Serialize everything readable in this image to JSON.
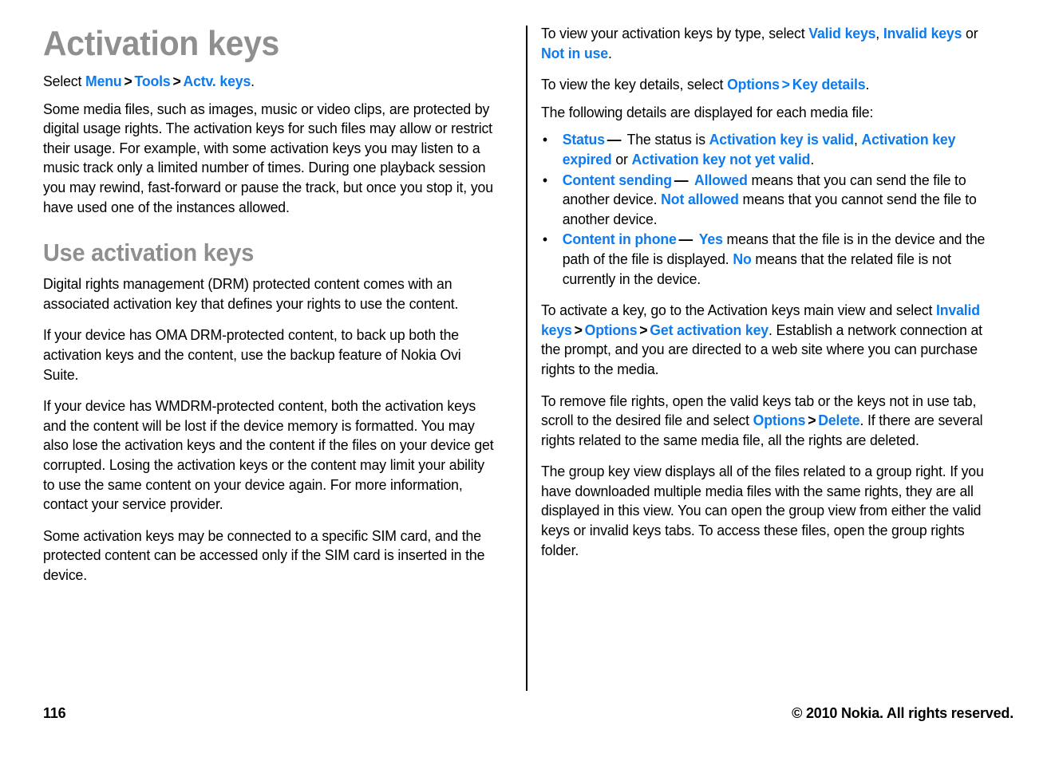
{
  "document": {
    "title": "Activation keys",
    "colors": {
      "heading_gray": "#8f8f8f",
      "link_blue": "#0d7bee",
      "body_black": "#000000",
      "page_background": "#ffffff"
    }
  },
  "left_column": {
    "heading": "Activation keys",
    "select_line": {
      "prefix": "Select ",
      "item1": "Menu",
      "sep1": ">",
      "item2": "Tools",
      "sep2": ">",
      "item3": "Actv. keys",
      "suffix": "."
    },
    "intro_paragraph": "Some media files, such as images, music or video clips, are protected by digital usage rights. The activation keys for such files may allow or restrict their usage. For example, with some activation keys you may listen to a music track only a limited number of times. During one playback session you may rewind, fast-forward or pause the track, but once you stop it, you have used one of the instances allowed.",
    "subheading": "Use activation keys",
    "paragraphs": [
      "Digital rights management (DRM) protected content comes with an associated activation key that defines your rights to use the content.",
      "If your device has OMA DRM-protected content, to back up both the activation keys and the content, use the backup feature of Nokia Ovi Suite.",
      "If your device has WMDRM-protected content, both the activation keys and the content will be lost if the device memory is formatted. You may also lose the activation keys and the content if the files on your device get corrupted. Losing the activation keys or the content may limit your ability to use the same content on your device again. For more information, contact your service provider.",
      "Some activation keys may be connected to a specific SIM card, and the protected content can be accessed only if the SIM card is inserted in the device."
    ]
  },
  "right_column": {
    "view_by_type": {
      "prefix": "To view your activation keys by type, select ",
      "link1": "Valid keys",
      "comma": ", ",
      "link2": "Invalid keys",
      "or": " or ",
      "link3": "Not in use",
      "suffix": "."
    },
    "key_details_line": {
      "prefix": "To view the key details, select ",
      "link1": "Options",
      "sep": ">",
      "link2": "Key details",
      "suffix": "."
    },
    "details_intro": "The following details are displayed for each media file:",
    "bullets": [
      {
        "bullet_char": "•",
        "term": "Status",
        "dash": "—",
        "text_1": " The status is ",
        "value_1": "Activation key is valid",
        "text_2": ", ",
        "value_2": "Activation key expired",
        "text_3": " or ",
        "value_3": "Activation key not yet valid",
        "text_4": "."
      },
      {
        "bullet_char": "•",
        "term": "Content sending",
        "dash": "—",
        "text_1": " ",
        "value_1": "Allowed",
        "text_2": " means that you can send the file to another device. ",
        "value_2": "Not allowed",
        "text_3": " means that you cannot send the file to another device.",
        "value_3": "",
        "text_4": ""
      },
      {
        "bullet_char": "•",
        "term": "Content in phone",
        "dash": "—",
        "text_1": " ",
        "value_1": "Yes",
        "text_2": " means that the file is in the device and the path of the file is displayed. ",
        "value_2": "No",
        "text_3": " means that the related file is not currently in the device.",
        "value_3": "",
        "text_4": ""
      }
    ],
    "activate_key": {
      "part1": "To activate a key, go to the Activation keys main view and select ",
      "link1": "Invalid keys",
      "sep1": ">",
      "link2": "Options",
      "sep2": ">",
      "link3": "Get activation key",
      "part2": ". Establish a network connection at the prompt, and you are directed to a web site where you can purchase rights to the media."
    },
    "remove_rights": {
      "part1": "To remove file rights, open the valid keys tab or the keys not in use tab, scroll to the desired file and select ",
      "link1": "Options",
      "sep1": ">",
      "link2": "Delete",
      "part2": ". If there are several rights related to the same media file, all the rights are deleted."
    },
    "group_key_paragraph": "The group key view displays all of the files related to a group right. If you have downloaded multiple media files with the same rights, they are all displayed in this view. You can open the group view from either the valid keys or invalid keys tabs. To access these files, open the group rights folder."
  },
  "footer": {
    "page_number": "116",
    "copyright": "© 2010 Nokia. All rights reserved."
  }
}
